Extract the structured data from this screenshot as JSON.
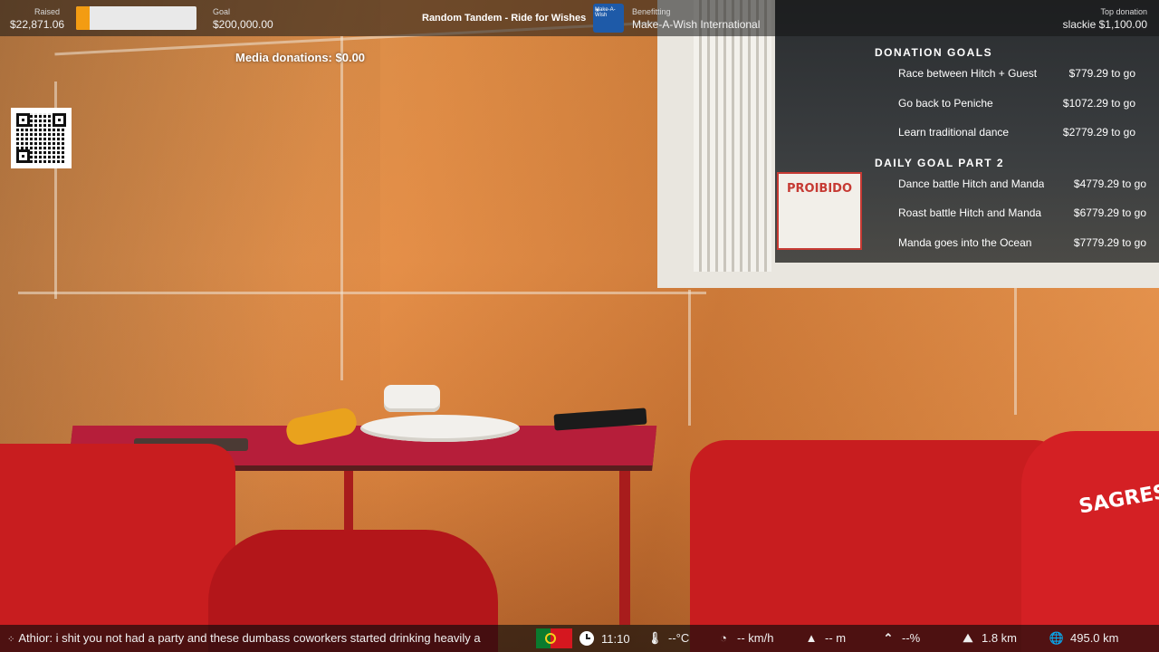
{
  "topbar": {
    "raised_label": "Raised",
    "raised_value": "$22,871.06",
    "raised_progress_fraction": 0.114,
    "goal_label": "Goal",
    "goal_value": "$200,000.00",
    "campaign_title": "Random Tandem - Ride for Wishes",
    "benefitting_label": "Benefitting",
    "benefitting_value": "Make-A-Wish International",
    "logo_text": "Make-A-Wish",
    "top_donation_label": "Top donation",
    "top_donation_value": "slackie $1,100.00",
    "progress_color": "#f39c12"
  },
  "media_donations": "Media donations: $0.00",
  "qr_code": {
    "icon": "qr-code"
  },
  "goals": {
    "heading": "DONATION GOALS",
    "items": [
      {
        "name": "Race between Hitch + Guest",
        "amount": "$779.29 to go"
      },
      {
        "name": "Go back to Peniche",
        "amount": "$1072.29 to go"
      },
      {
        "name": "Learn traditional dance",
        "amount": "$2779.29 to go"
      }
    ]
  },
  "daily_goals": {
    "heading": "DAILY GOAL PART 2",
    "items": [
      {
        "name": "Dance battle Hitch and Manda",
        "amount": "$4779.29 to go"
      },
      {
        "name": "Roast battle Hitch and Manda",
        "amount": "$6779.29 to go"
      },
      {
        "name": "Manda goes into the Ocean",
        "amount": "$7779.29 to go"
      }
    ]
  },
  "bottombar": {
    "chat_text": "Athior: i shit you not had a party and these dumbass coworkers started drinking heavily a",
    "flag": "portugal-flag",
    "time": "11:10",
    "temperature": "--°C",
    "speed": "-- km/h",
    "altitude": "-- m",
    "incline": "--%",
    "distance_remaining": "1.8 km",
    "distance_total": "495.0 km"
  },
  "scene": {
    "sign_text": "PROIBIDO",
    "chair_brand": "SAGRES"
  }
}
